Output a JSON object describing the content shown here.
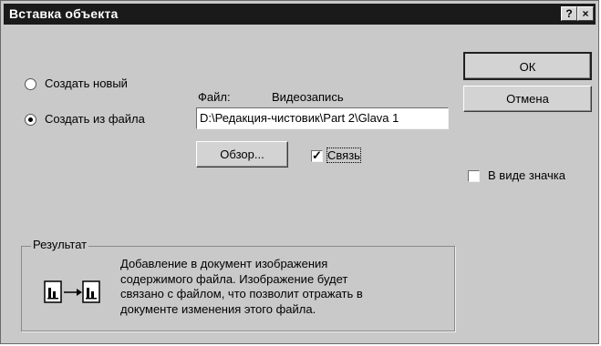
{
  "window": {
    "title": "Вставка объекта",
    "help_button": "?",
    "close_button": "×"
  },
  "options": {
    "create_new": "Создать новый",
    "create_from_file": "Создать из файла",
    "selected": "create_from_file"
  },
  "file": {
    "label": "Файл:",
    "type": "Видеозапись",
    "path": "D:\\Редакция-чистовик\\Part 2\\Glava 1"
  },
  "buttons": {
    "browse": "Обзор...",
    "ok": "ОК",
    "cancel": "Отмена"
  },
  "link": {
    "label": "Связь",
    "checked": true
  },
  "display_as_icon": {
    "label": "В виде значка",
    "checked": false
  },
  "result": {
    "title": "Результат",
    "lines": [
      "Добавление в документ изображения",
      "содержимого файла.  Изображение будет",
      "связано с файлом, что позволит отражать в",
      "документе изменения этого файла."
    ]
  }
}
